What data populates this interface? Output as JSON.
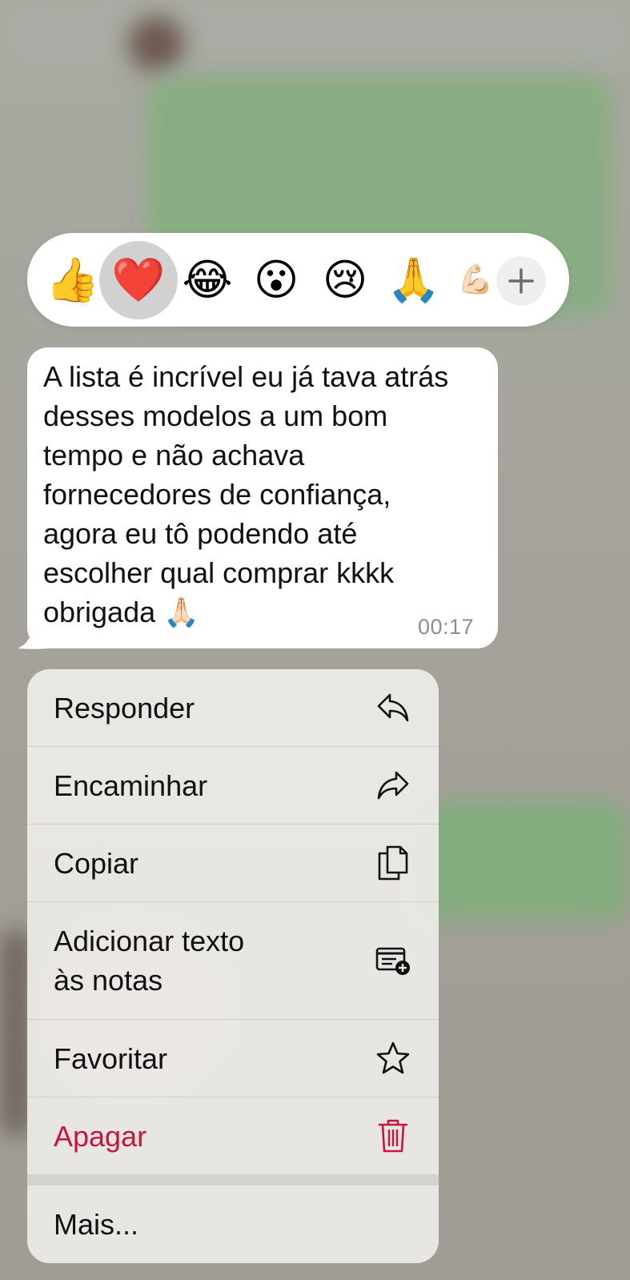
{
  "reactions": [
    {
      "emoji": "👍",
      "name": "thumbs-up"
    },
    {
      "emoji": "❤️",
      "name": "red-heart",
      "selected": true
    },
    {
      "emoji": "😂",
      "name": "tears-of-joy"
    },
    {
      "emoji": "😮",
      "name": "surprised"
    },
    {
      "emoji": "😢",
      "name": "crying"
    },
    {
      "emoji": "🙏",
      "name": "folded-hands"
    },
    {
      "emoji": "💪🏻",
      "name": "flexed-biceps-partial"
    }
  ],
  "add_reaction_icon": "plus-icon",
  "message": {
    "lines": [
      "A lista é incrível eu já tava atrás",
      "desses modelos a um bom",
      "tempo e não achava",
      "fornecedores de confiança,",
      "agora eu tô podendo até",
      "escolher qual comprar kkkk",
      "obrigada 🙏🏻"
    ],
    "time": "00:17"
  },
  "menu": {
    "reply": {
      "label": "Responder",
      "icon": "reply-icon"
    },
    "forward": {
      "label": "Encaminhar",
      "icon": "forward-icon"
    },
    "copy": {
      "label": "Copiar",
      "icon": "copy-icon"
    },
    "add_note": {
      "label_line1": "Adicionar texto",
      "label_line2": "às notas",
      "icon": "note-add-icon"
    },
    "favorite": {
      "label": "Favoritar",
      "icon": "star-icon"
    },
    "delete": {
      "label": "Apagar",
      "icon": "trash-icon"
    },
    "more": {
      "label": "Mais..."
    }
  },
  "colors": {
    "danger": "#c7163d",
    "bubble": "#ffffff",
    "menu_bg": "#ecebe8"
  }
}
